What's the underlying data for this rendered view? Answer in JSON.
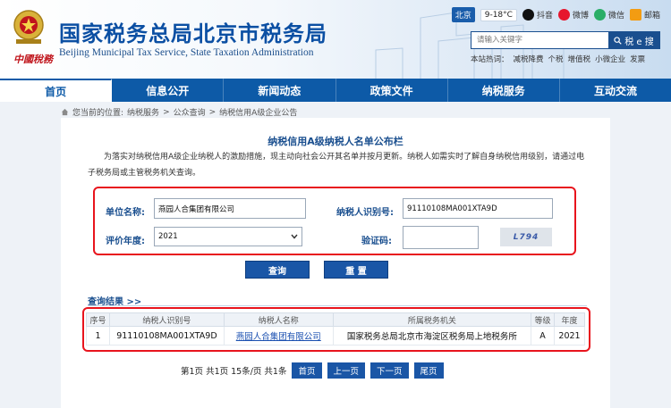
{
  "header": {
    "brand_cn": "中國稅務",
    "title": "国家税务总局北京市税务局",
    "subtitle": "Beijing Municipal Tax Service, State Taxation Administration",
    "city": "北京",
    "weather": "9-18°C",
    "social": [
      {
        "label": "抖音",
        "icon": "tiktok-icon"
      },
      {
        "label": "微博",
        "icon": "weibo-icon"
      },
      {
        "label": "微信",
        "icon": "wechat-icon"
      },
      {
        "label": "邮箱",
        "icon": "mail-icon"
      }
    ],
    "search_placeholder": "请输入关键字",
    "search_button": "税 e 搜",
    "hot_label": "本站热词：",
    "hot_words": [
      "减税降费",
      "个税",
      "增值税",
      "小微企业",
      "发票"
    ]
  },
  "nav": {
    "items": [
      "首页",
      "信息公开",
      "新闻动态",
      "政策文件",
      "纳税服务",
      "互动交流"
    ],
    "active": "首页"
  },
  "breadcrumb": {
    "prefix": "您当前的位置:",
    "items": [
      "纳税服务",
      "公众查询",
      "纳税信用A级企业公告"
    ],
    "separator": ">"
  },
  "main": {
    "title": "纳税信用A级纳税人名单公布栏",
    "intro": "为落实对纳税信用A级企业纳税人的激励措施，现主动向社会公开其名单并按月更新。纳税人如需实时了解自身纳税信用级别，请通过电子税务局或主管税务机关查询。",
    "form": {
      "unit_name_label": "单位名称:",
      "unit_name_value": "燕园人合集团有限公司",
      "taxpayer_id_label": "纳税人识别号:",
      "taxpayer_id_value": "91110108MA001XTA9D",
      "year_label": "评价年度:",
      "year_value": "2021",
      "captcha_label": "验证码:",
      "captcha_value": "",
      "captcha_image_text": "L794"
    },
    "buttons": {
      "query": "查询",
      "reset": "重 置"
    },
    "results_label": "查询结果 >>",
    "table": {
      "headers": [
        "序号",
        "纳税人识别号",
        "纳税人名称",
        "所属税务机关",
        "等级",
        "年度"
      ],
      "rows": [
        [
          "1",
          "91110108MA001XTA9D",
          "燕园人合集团有限公司",
          "国家税务总局北京市海淀区税务局上地税务所",
          "A",
          "2021"
        ]
      ]
    },
    "pager": {
      "info": "第1页  共1页  15条/页  共1条",
      "first": "首页",
      "prev": "上一页",
      "next": "下一页",
      "last": "尾页"
    }
  },
  "colors": {
    "primary": "#0d5aa7",
    "highlight": "#e8141d",
    "brand_red": "#c0151c"
  }
}
